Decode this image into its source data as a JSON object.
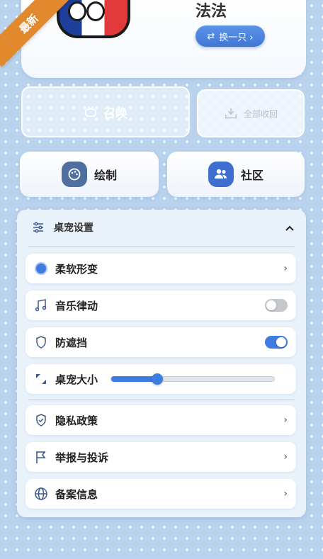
{
  "badge": {
    "text": "最新"
  },
  "pet": {
    "name": "法法",
    "switch_label": "换一只 ›"
  },
  "actions": {
    "summon_label": "召唤",
    "recall_label": "全部收回",
    "draw_label": "绘制",
    "community_label": "社区"
  },
  "settings": {
    "title": "桌宠设置",
    "items": [
      {
        "label": "柔软形变",
        "icon": "circle-icon",
        "control": "chevron"
      },
      {
        "label": "音乐律动",
        "icon": "music-note-icon",
        "control": "toggle",
        "on": false
      },
      {
        "label": "防遮挡",
        "icon": "shield-icon",
        "control": "toggle",
        "on": true
      },
      {
        "label": "桌宠大小",
        "icon": "resize-icon",
        "control": "slider",
        "value": 0.28
      }
    ],
    "info_items": [
      {
        "label": "隐私政策",
        "icon": "shield-check-icon"
      },
      {
        "label": "举报与投诉",
        "icon": "flag-icon"
      },
      {
        "label": "备案信息",
        "icon": "globe-icon"
      }
    ],
    "chevron": "›"
  },
  "colors": {
    "accent": "#3d7de0",
    "background": "#b9d3ee",
    "badge": "#e2892e",
    "toggle_off": "#c4c8cd"
  }
}
